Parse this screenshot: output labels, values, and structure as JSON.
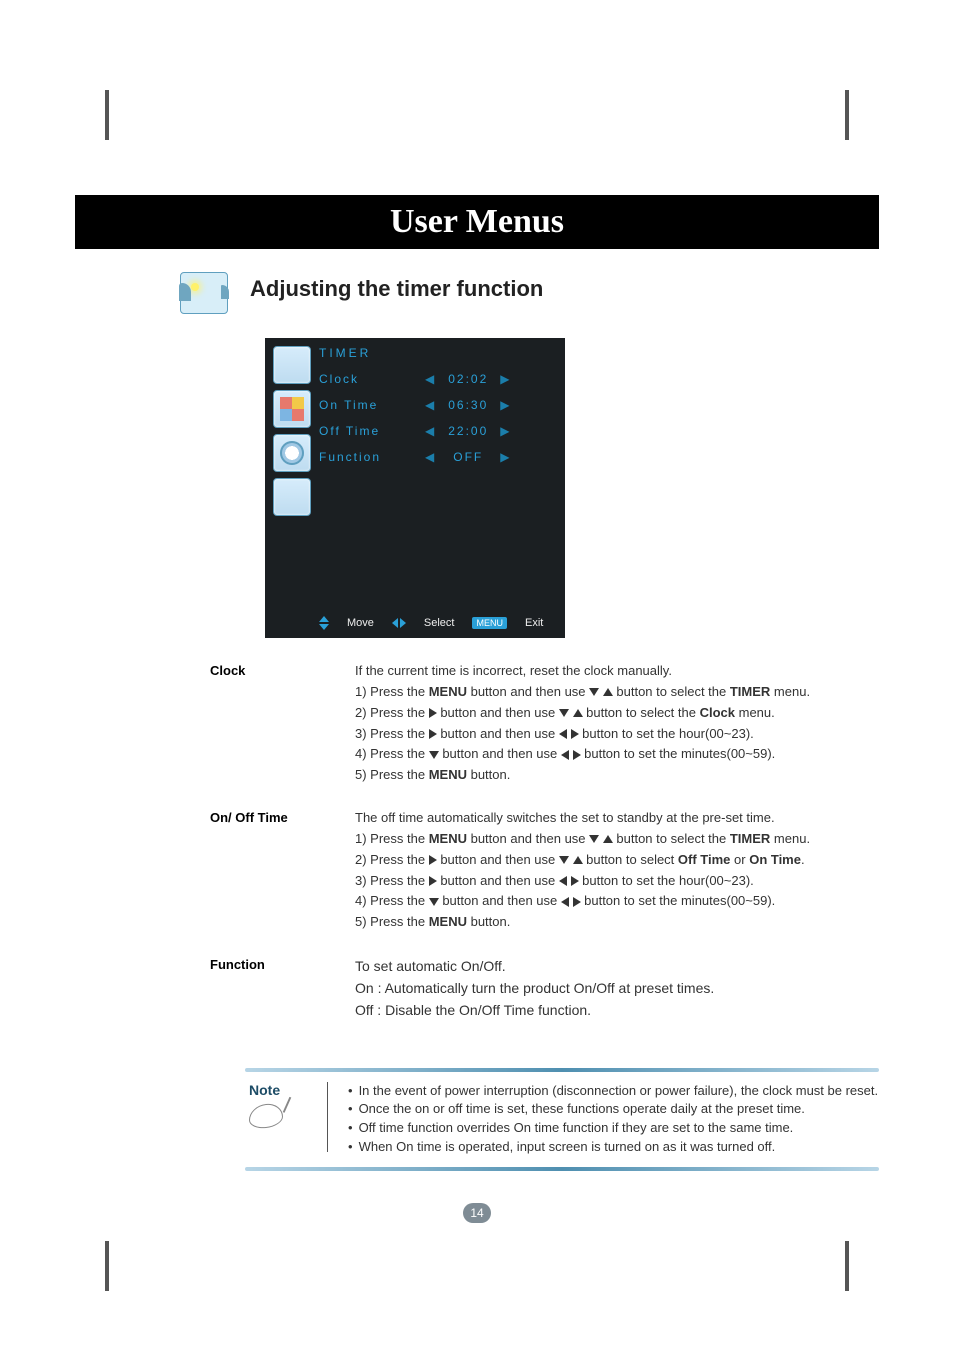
{
  "title": "User Menus",
  "section_title": "Adjusting the timer function",
  "osd": {
    "header": "TIMER",
    "rows": [
      {
        "label": "Clock",
        "value": "02:02"
      },
      {
        "label": "On Time",
        "value": "06:30"
      },
      {
        "label": "Off Time",
        "value": "22:00"
      },
      {
        "label": "Function",
        "value": "OFF"
      }
    ],
    "footer": {
      "move": "Move",
      "select": "Select",
      "menu": "MENU",
      "exit": "Exit"
    }
  },
  "desc_clock": {
    "label": "Clock",
    "intro": "If the current time is incorrect, reset the clock manually.",
    "s1a": "1) Press the ",
    "s1b": "MENU",
    "s1c": " button and then use ",
    "s1d": " button to select the ",
    "s1e": "TIMER",
    "s1f": " menu.",
    "s2a": "2) Press the ",
    "s2b": " button and then use ",
    "s2c": " button to select the ",
    "s2d": "Clock",
    "s2e": " menu.",
    "s3a": "3) Press the ",
    "s3b": " button and then use ",
    "s3c": " button to set the hour(00~23).",
    "s4a": "4) Press the ",
    "s4b": " button and then use ",
    "s4c": " button to set the minutes(00~59).",
    "s5a": "5) Press the ",
    "s5b": "MENU",
    "s5c": " button."
  },
  "desc_onoff": {
    "label": "On/ Off Time",
    "intro": "The off time automatically switches the set to standby at the pre-set time.",
    "s1a": "1) Press the ",
    "s1b": "MENU",
    "s1c": " button and then use ",
    "s1d": " button to select the ",
    "s1e": "TIMER",
    "s1f": " menu.",
    "s2a": "2) Press the ",
    "s2b": " button and then use ",
    "s2c": " button to select ",
    "s2d": "Off Time",
    "s2e": " or ",
    "s2f": "On Time",
    "s2g": ".",
    "s3a": "3) Press the ",
    "s3b": " button and then use ",
    "s3c": " button to set the hour(00~23).",
    "s4a": "4) Press the ",
    "s4b": " button and then use ",
    "s4c": " button to set the minutes(00~59).",
    "s5a": "5) Press the ",
    "s5b": "MENU",
    "s5c": " button."
  },
  "desc_function": {
    "label": "Function",
    "l1": "To set automatic On/Off.",
    "l2": "On : Automatically turn the product On/Off at preset times.",
    "l3": "Off : Disable the On/Off Time function."
  },
  "note": {
    "label": "Note",
    "items": [
      "In the event of power interruption (disconnection or power failure), the clock must be reset.",
      "Once the on or off time is set, these functions operate daily at the preset time.",
      "Off time function overrides On time function if they are set to the same time.",
      "When On time is operated, input screen is turned on as it was turned off."
    ]
  },
  "page_number": "14",
  "chart_data": {
    "type": "table",
    "title": "TIMER menu values",
    "categories": [
      "Clock",
      "On Time",
      "Off Time",
      "Function"
    ],
    "values": [
      "02:02",
      "06:30",
      "22:00",
      "OFF"
    ]
  }
}
